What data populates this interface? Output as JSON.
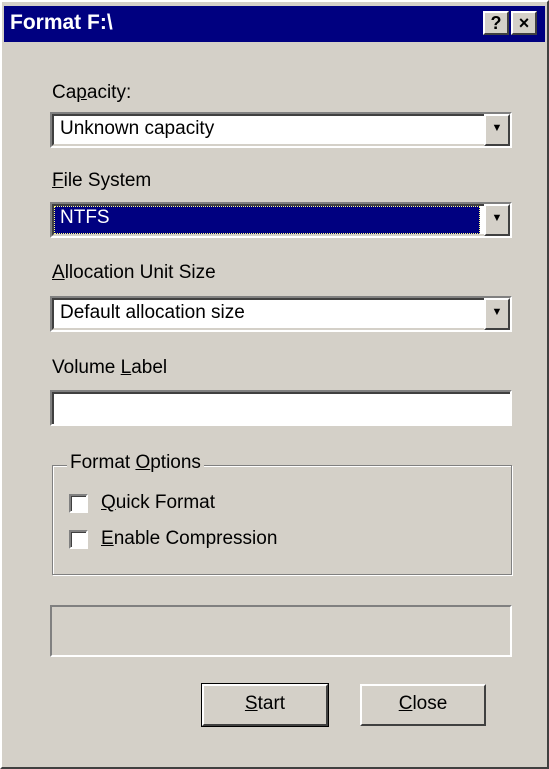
{
  "window": {
    "title": "Format F:\\",
    "help_label": "?",
    "close_label": "×"
  },
  "capacity": {
    "label_pre": "Ca",
    "label_key": "p",
    "label_post": "acity:",
    "value": "Unknown capacity"
  },
  "file_system": {
    "label_pre": "",
    "label_key": "F",
    "label_post": "ile System",
    "value": "NTFS"
  },
  "allocation": {
    "label_pre": "",
    "label_key": "A",
    "label_post": "llocation Unit Size",
    "value": "Default allocation size"
  },
  "volume_label": {
    "label_pre": "Volume ",
    "label_key": "L",
    "label_post": "abel",
    "value": ""
  },
  "format_options": {
    "title_pre": "Format ",
    "title_key": "O",
    "title_post": "ptions",
    "quick": {
      "key": "Q",
      "rest": "uick Format",
      "checked": false
    },
    "compression": {
      "key": "E",
      "rest": "nable Compression",
      "checked": false
    }
  },
  "progress": {
    "value": 0
  },
  "buttons": {
    "start_key": "S",
    "start_rest": "tart",
    "close_key": "C",
    "close_rest": "lose"
  },
  "colors": {
    "face": "#d4d0c8",
    "titlebar": "#000080",
    "highlight": "#000080"
  },
  "icons": {
    "dropdown": "triangle-down"
  }
}
